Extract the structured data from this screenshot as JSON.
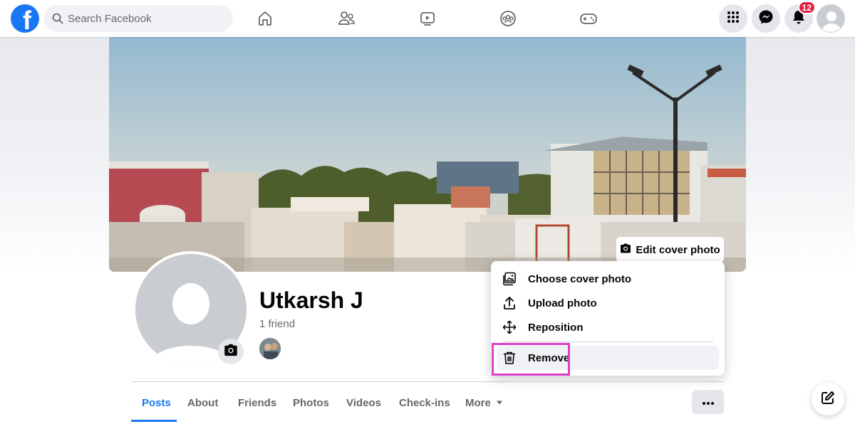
{
  "header": {
    "search_placeholder": "Search Facebook",
    "nav_icons": [
      "home-icon",
      "friends-icon",
      "watch-icon",
      "groups-icon",
      "gaming-icon"
    ],
    "notifications_badge": "12",
    "logo_letter": "f"
  },
  "cover": {
    "edit_label": "Edit cover photo"
  },
  "profile": {
    "name": "Utkarsh J",
    "friends": "1 friend"
  },
  "menu": {
    "items": [
      {
        "label": "Choose cover photo",
        "icon": "image-icon"
      },
      {
        "label": "Upload photo",
        "icon": "upload-icon"
      },
      {
        "label": "Reposition",
        "icon": "move-icon"
      },
      {
        "label": "Remove",
        "icon": "trash-icon"
      }
    ]
  },
  "tabs": [
    "Posts",
    "About",
    "Friends",
    "Photos",
    "Videos",
    "Check-ins",
    "More"
  ],
  "colors": {
    "brand": "#1877f2",
    "badge": "#e41e3f",
    "highlight": "#e040c9"
  }
}
